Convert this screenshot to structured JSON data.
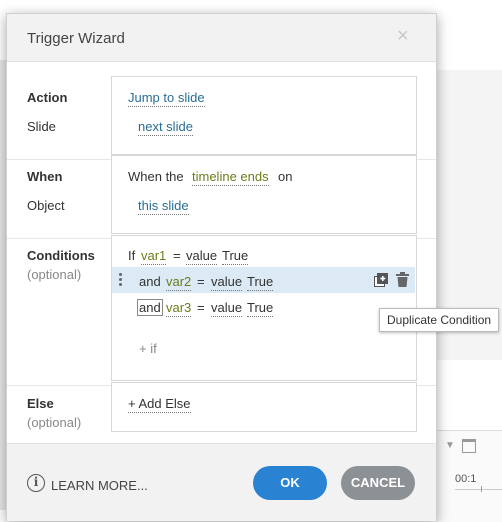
{
  "dialog": {
    "title": "Trigger Wizard",
    "close_icon": "close-icon"
  },
  "action": {
    "label": "Action",
    "value": "Jump to slide",
    "slide_label": "Slide",
    "slide_value": "next slide"
  },
  "when": {
    "label": "When",
    "prefix": "When the",
    "event": "timeline ends",
    "suffix": "on",
    "object_label": "Object",
    "object_value": "this slide"
  },
  "conditions": {
    "label": "Conditions",
    "optional": "(optional)",
    "rows": [
      {
        "connector": "If",
        "variable": "var1",
        "operator": "=",
        "kind": "value",
        "value": "True"
      },
      {
        "connector": "and",
        "variable": "var2",
        "operator": "=",
        "kind": "value",
        "value": "True"
      },
      {
        "connector": "and",
        "variable": "var3",
        "operator": "=",
        "kind": "value",
        "value": "True"
      }
    ],
    "add_if": "+ if",
    "tooltip": "Duplicate Condition"
  },
  "else": {
    "label": "Else",
    "optional": "(optional)",
    "add_else": "+ Add Else"
  },
  "footer": {
    "learn_more": "LEARN MORE...",
    "ok": "OK",
    "cancel": "CANCEL"
  },
  "background": {
    "timecode": "00:1"
  },
  "colors": {
    "ok_button": "#2a82d3",
    "cancel_button": "#8c9196",
    "highlight_row": "#dbeaf5",
    "link": "#2a6e93",
    "variable": "#6b7d1a"
  }
}
